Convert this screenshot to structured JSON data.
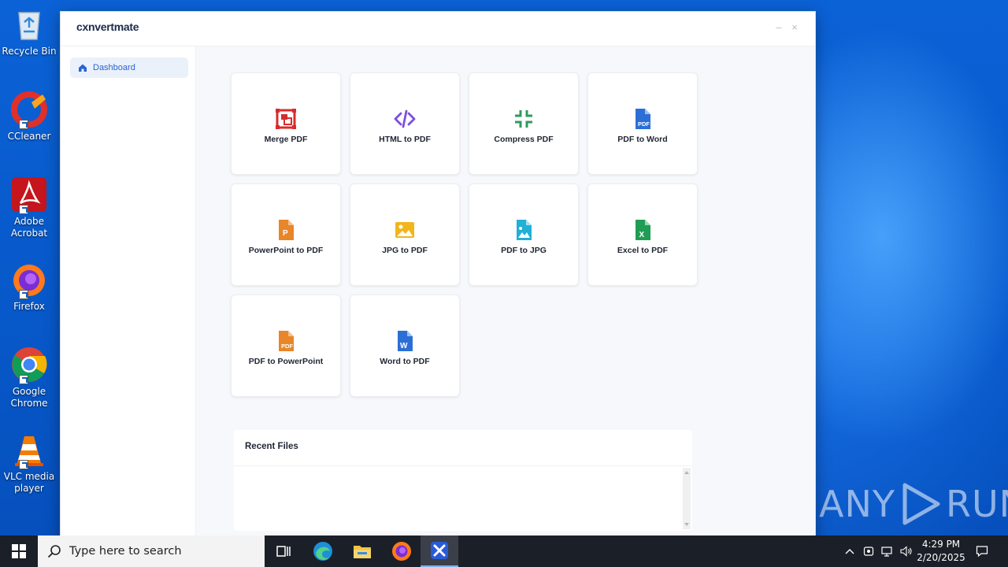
{
  "desktop": {
    "icons": [
      {
        "label": "Recycle Bin"
      },
      {
        "label": "CCleaner"
      },
      {
        "label": "Adobe Acrobat"
      },
      {
        "label": "Firefox"
      },
      {
        "label": "Google Chrome"
      },
      {
        "label": "VLC media player"
      }
    ],
    "watermark": "ANY RUN"
  },
  "app": {
    "logo": "cxnvertmate",
    "controls": {
      "minimize": "–",
      "close": "×"
    },
    "sidebar": {
      "items": [
        {
          "label": "Dashboard",
          "icon": "home-icon"
        }
      ]
    },
    "tools": [
      {
        "label": "Merge PDF",
        "icon": "merge-icon",
        "color": "#d92b2b"
      },
      {
        "label": "HTML to PDF",
        "icon": "code-icon",
        "color": "#7b4fe0"
      },
      {
        "label": "Compress PDF",
        "icon": "compress-icon",
        "color": "#2e9b5f"
      },
      {
        "label": "PDF to Word",
        "icon": "pdf-file-icon",
        "color": "#2b6fd6"
      },
      {
        "label": "PowerPoint to PDF",
        "icon": "powerpoint-file-icon",
        "color": "#e8862a"
      },
      {
        "label": "JPG to PDF",
        "icon": "image-icon",
        "color": "#f2b51b"
      },
      {
        "label": "PDF to JPG",
        "icon": "image-file-icon",
        "color": "#21b0d6"
      },
      {
        "label": "Excel to PDF",
        "icon": "excel-file-icon",
        "color": "#1f9d55"
      },
      {
        "label": "PDF to PowerPoint",
        "icon": "pdf-file-icon",
        "color": "#e8862a"
      },
      {
        "label": "Word to PDF",
        "icon": "word-file-icon",
        "color": "#2b6fd6"
      }
    ],
    "recent": {
      "title": "Recent Files"
    }
  },
  "taskbar": {
    "search_placeholder": "Type here to search",
    "time": "4:29 PM",
    "date": "2/20/2025"
  }
}
